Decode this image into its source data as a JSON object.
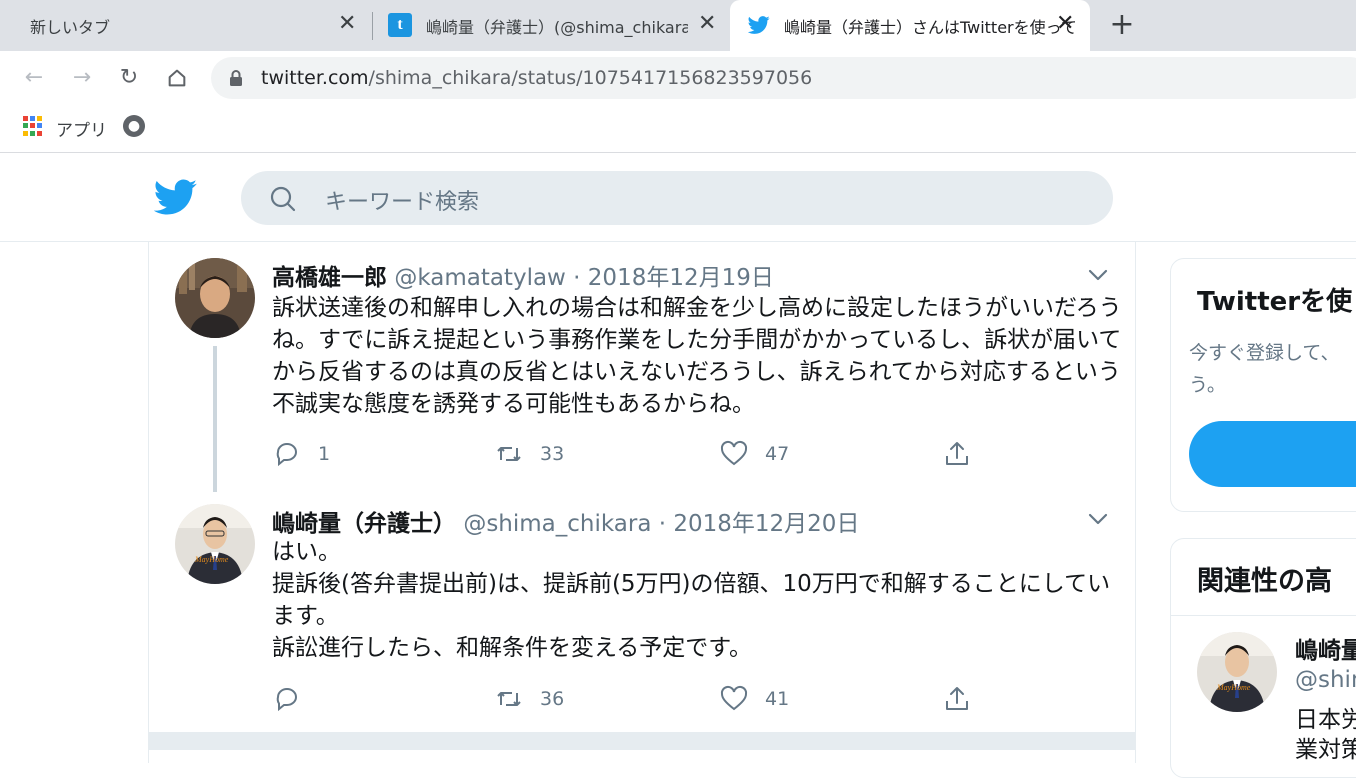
{
  "browser": {
    "tabs": [
      {
        "title": "新しいタブ",
        "close": "✕"
      },
      {
        "title": "嶋崎量（弁護士）(@shima_chikara",
        "close": "✕"
      },
      {
        "title": "嶋崎量（弁護士）さんはTwitterを使っています",
        "close": "✕"
      }
    ],
    "new_tab": "+",
    "url_host": "twitter.com",
    "url_path": "/shima_chikara/status/1075417156823597056",
    "bookmarks": {
      "apps_label": "アプリ"
    }
  },
  "twitter": {
    "search_placeholder": "キーワード検索",
    "tweets": [
      {
        "name": "高橋雄一郎",
        "handle": "@kamatatylaw",
        "dot": "·",
        "date": "2018年12月19日",
        "lines": [
          "訴状送達後の和解申し入れの場合は和解金を少し高めに設定したほうがいいだろうね。すでに訴え提起という事務作業をした分手間がかかっているし、訴状が届いてから反省するのは真の反省とはいえないだろうし、訴えられてから対応するという不誠実な態度を誘発する可能性もあるからね。"
        ],
        "reply_count": "1",
        "retweet_count": "33",
        "like_count": "47"
      },
      {
        "name": "嶋崎量（弁護士）",
        "handle": "@shima_chikara",
        "dot": "·",
        "date": "2018年12月20日",
        "lines": [
          "はい。",
          "提訴後(答弁書提出前)は、提訴前(5万円)の倍額、10万円で和解することにしています。",
          "訴訟進行したら、和解条件を変える予定です。"
        ],
        "reply_count": "",
        "retweet_count": "36",
        "like_count": "41"
      }
    ],
    "sidebar": {
      "signup_title": "Twitterを使",
      "signup_text": "今すぐ登録して、\nう。",
      "related_title": "関連性の高",
      "related_user": {
        "name": "嶋崎量",
        "handle": "@shim",
        "bio": "日本労\n業対策"
      }
    }
  },
  "colors": {
    "twitter_blue": "#1da1f2",
    "muted_text": "#657786",
    "border": "#e6ecf0"
  }
}
